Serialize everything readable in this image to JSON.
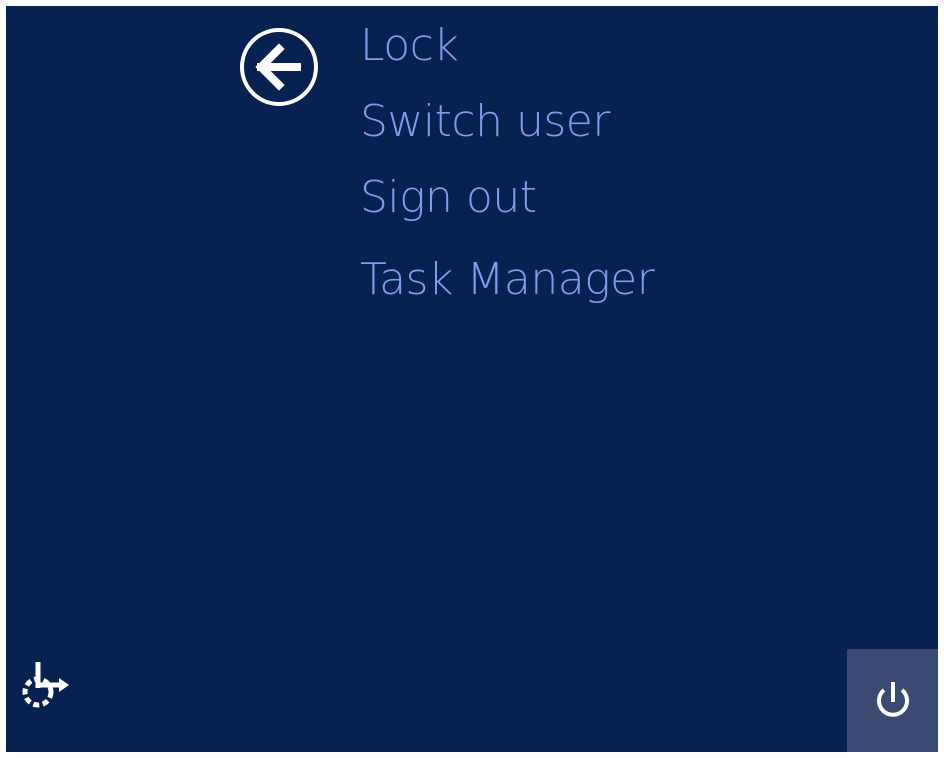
{
  "menu": {
    "items": [
      {
        "label": "Lock"
      },
      {
        "label": "Switch user"
      },
      {
        "label": "Sign out"
      },
      {
        "label": "Task Manager"
      }
    ]
  },
  "icons": {
    "back": "back-arrow-icon",
    "ease_of_access": "ease-of-access-icon",
    "power": "power-icon"
  },
  "colors": {
    "background": "#072150",
    "menu_text": "#7e9ee9",
    "power_tile": "#3b4a72",
    "icon": "#ffffff"
  }
}
